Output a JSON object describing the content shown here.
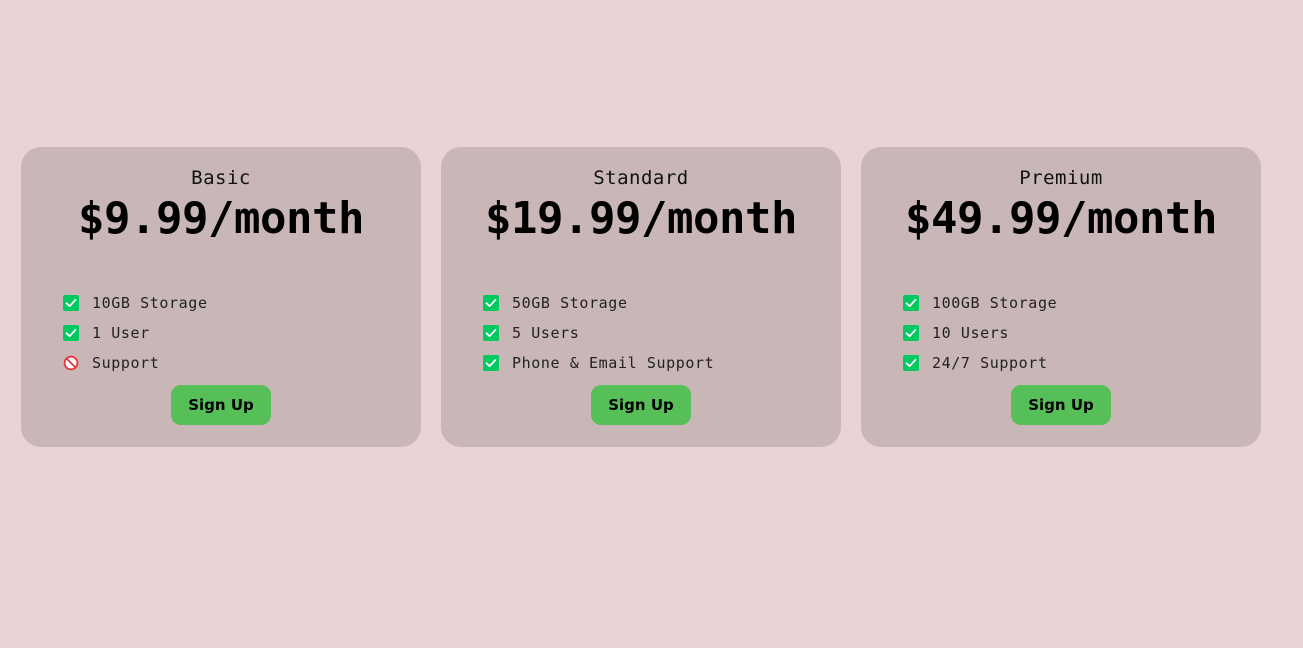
{
  "plans": [
    {
      "name": "Basic",
      "price": "$9.99/month",
      "features": [
        {
          "text": "10GB Storage",
          "included": true,
          "icon": "check-icon"
        },
        {
          "text": "1 User",
          "included": true,
          "icon": "check-icon"
        },
        {
          "text": "Support",
          "included": false,
          "icon": "prohibited-icon"
        }
      ],
      "button": "Sign Up"
    },
    {
      "name": "Standard",
      "price": "$19.99/month",
      "features": [
        {
          "text": "50GB Storage",
          "included": true,
          "icon": "check-icon"
        },
        {
          "text": "5 Users",
          "included": true,
          "icon": "check-icon"
        },
        {
          "text": "Phone & Email Support",
          "included": true,
          "icon": "check-icon"
        }
      ],
      "button": "Sign Up"
    },
    {
      "name": "Premium",
      "price": "$49.99/month",
      "features": [
        {
          "text": "100GB Storage",
          "included": true,
          "icon": "check-icon"
        },
        {
          "text": "10 Users",
          "included": true,
          "icon": "check-icon"
        },
        {
          "text": "24/7 Support",
          "included": true,
          "icon": "check-icon"
        }
      ],
      "button": "Sign Up"
    }
  ],
  "colors": {
    "page_background": "#ead3d4",
    "card_background": "#c9b7b7",
    "button": "#57bf57",
    "check": "#00c95f",
    "prohibited": "#e8323a"
  }
}
